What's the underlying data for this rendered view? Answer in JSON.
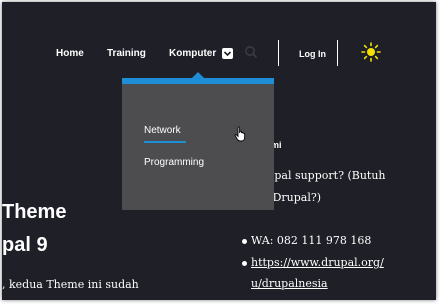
{
  "nav": {
    "home": "Home",
    "training": "Training",
    "komputer": "Komputer",
    "login": "Log In",
    "icons": [
      "chevron-down-icon",
      "search-icon",
      "sun-icon"
    ]
  },
  "dropdown": {
    "items": [
      "Network",
      "Programming"
    ],
    "accent": "#1e8fd6"
  },
  "main": {
    "heading_line1": "Theme",
    "heading_line2": "pal 9",
    "body_line": ", kedua Theme ini sudah"
  },
  "sidebar": {
    "partial_heading": "ami",
    "support_line1": "rupal support? (Butuh",
    "support_line2": "n Drupal?)",
    "wa": "WA: 082 111 978 168",
    "link_line1": "https://www.drupal.org/",
    "link_line2": "u/drupalnesia"
  },
  "colors": {
    "background": "#1e1f27",
    "dropdown_bg": "#4d4d4f",
    "sun": "#f5e100"
  }
}
